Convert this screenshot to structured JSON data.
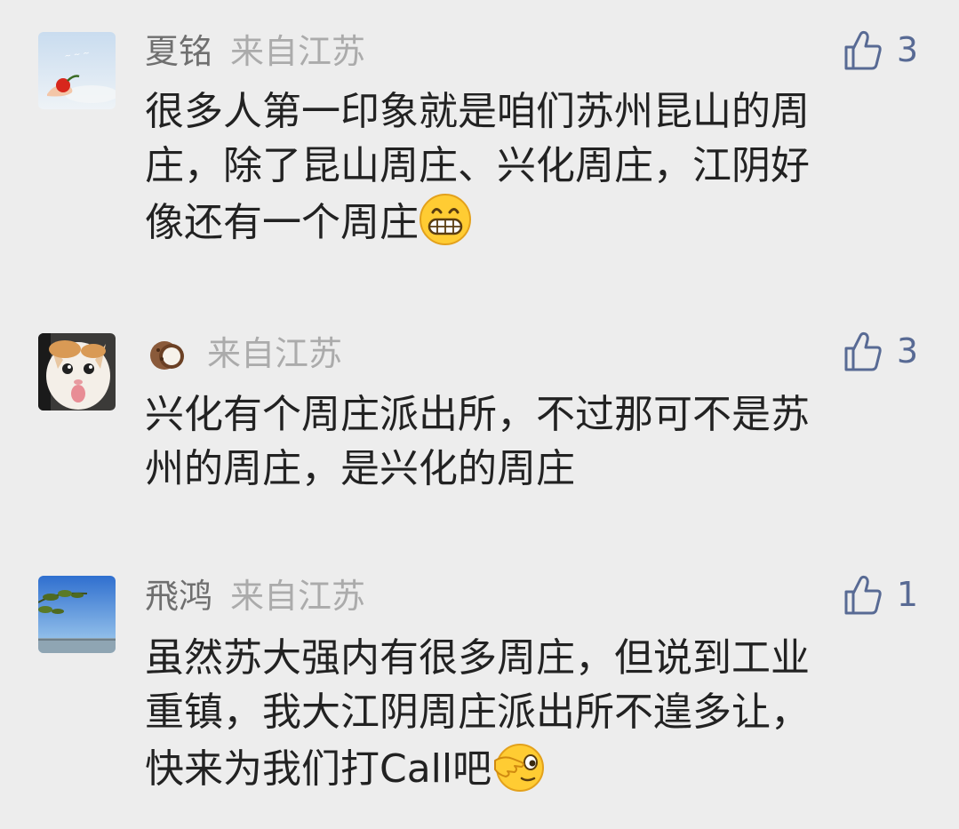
{
  "comments": [
    {
      "nickname": "夏铭",
      "location": "来自江苏",
      "likes": "3",
      "avatar": "red-pepper-sky-avatar",
      "lines": [
        "很多人第一印象就是咱们苏州昆山的周",
        "庄，除了昆山周庄、兴化周庄，江阴好",
        "像还有一个周庄"
      ],
      "emoji": "grinning-face-emoji"
    },
    {
      "nickname": "",
      "nickname_icon": "coconut-icon",
      "location": "来自江苏",
      "likes": "3",
      "avatar": "cat-avatar",
      "lines": [
        "兴化有个周庄派出所，不过那可不是苏",
        "州的周庄，是兴化的周庄"
      ]
    },
    {
      "nickname": "飛鸿",
      "location": "来自江苏",
      "likes": "1",
      "avatar": "tree-bridge-landscape-avatar",
      "lines": [
        "虽然苏大强内有很多周庄，但说到工业",
        "重镇，我大江阴周庄派出所不遑多让，",
        "快来为我们打Call吧"
      ],
      "emoji": "face-with-peeking-eye-emoji"
    }
  ],
  "colors": {
    "background": "#ededed",
    "like_icon": "#586a94",
    "nickname": "#6f6f6f",
    "location": "#ababab",
    "text": "#222222"
  }
}
